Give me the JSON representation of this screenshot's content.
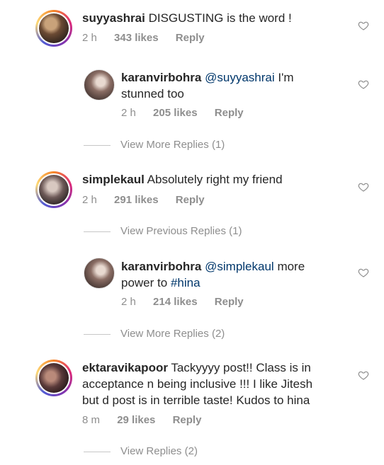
{
  "comments": [
    {
      "username": "suyyashrai",
      "text": "DISGUSTING is the word !",
      "time": "2 h",
      "likes": "343 likes",
      "reply_label": "Reply"
    },
    {
      "username": "karanvirbohra",
      "mention": "@suyyashrai",
      "text_line1_rest": "I'm",
      "text_line2": "stunned too",
      "time": "2 h",
      "likes": "205 likes",
      "reply_label": "Reply"
    },
    {
      "view_more_replies": "View More Replies (1)"
    },
    {
      "username": "simplekaul",
      "text": "Absolutely right my friend",
      "time": "2 h",
      "likes": "291 likes",
      "reply_label": "Reply"
    },
    {
      "view_previous_replies": "View Previous Replies (1)"
    },
    {
      "username": "karanvirbohra",
      "mention": "@simplekaul",
      "text_line1_rest": "more",
      "text_line2_prefix": "power to",
      "hashtag": "#hina",
      "time": "2 h",
      "likes": "214 likes",
      "reply_label": "Reply"
    },
    {
      "view_more_replies": "View More Replies (2)"
    },
    {
      "username": "ektaravikapoor",
      "text_line1": "Tackyyyy post!! Class is in",
      "text_line2": "acceptance n being inclusive !!! I like Jitesh",
      "text_line3": "but d post is in terrible taste! Kudos to hina",
      "time": "8 m",
      "likes": "29 likes",
      "reply_label": "Reply"
    },
    {
      "view_replies": "View Replies (2)"
    }
  ],
  "icons": {
    "like": "heart-outline-icon"
  }
}
